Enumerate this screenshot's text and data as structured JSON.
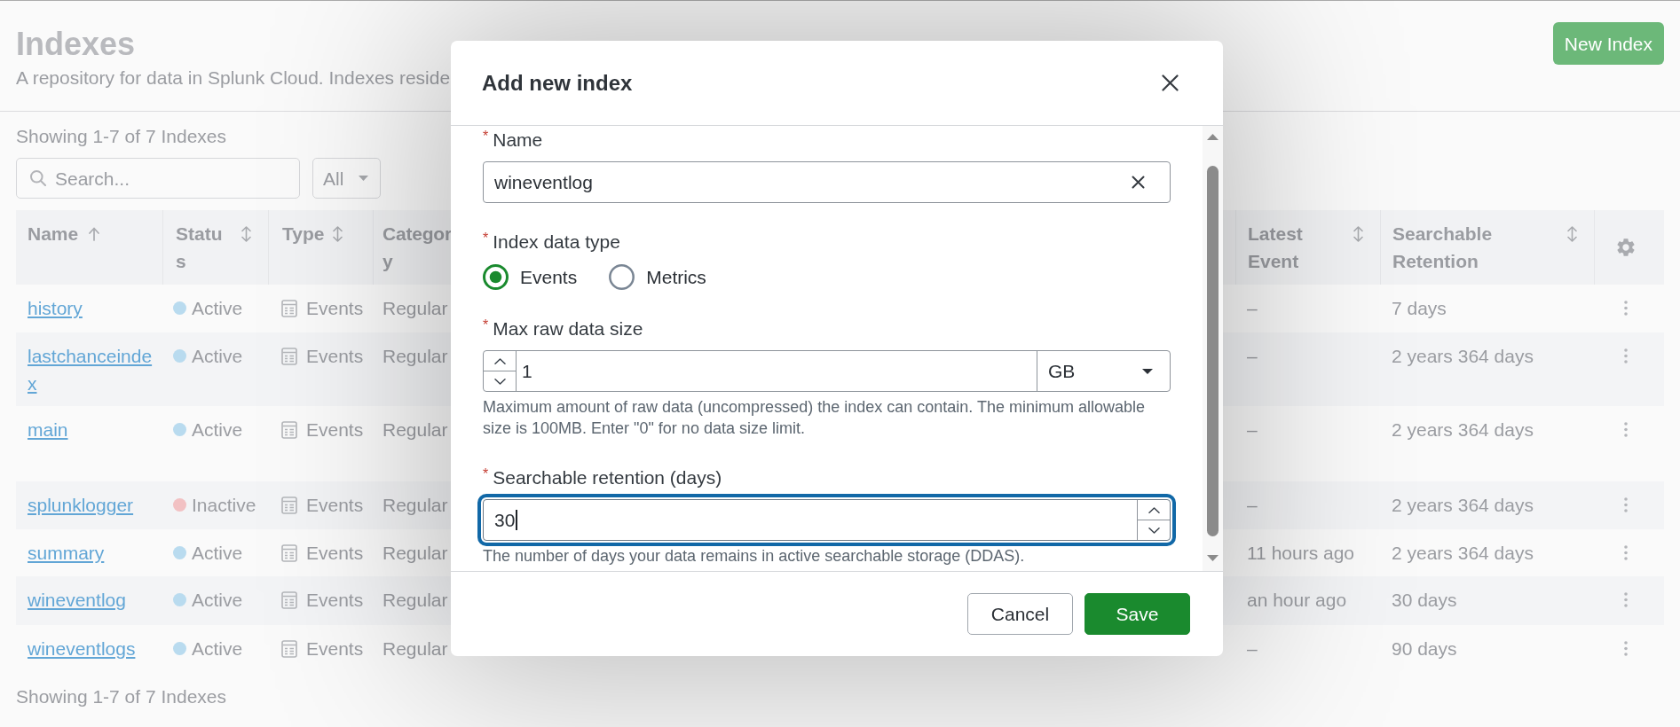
{
  "page": {
    "title": "Indexes",
    "description": "A repository for data in Splunk Cloud. Indexes reside",
    "new_button": "New Index",
    "count_top": "Showing 1-7 of 7 Indexes",
    "search": {
      "placeholder": "Search..."
    },
    "filter": {
      "value": "All"
    },
    "count_bottom": "Showing 1-7 of 7 Indexes"
  },
  "table": {
    "columns": [
      {
        "label": "Name",
        "sorted": true
      },
      {
        "label": "Status",
        "sorted": false
      },
      {
        "label": "Type",
        "sorted": false
      },
      {
        "label": "Category"
      },
      {
        "label": "Latest Event",
        "sorted": false
      },
      {
        "label": "Searchable Retention",
        "sorted": false
      }
    ],
    "rows": [
      {
        "name": "history",
        "status": "Active",
        "color": "#b9dbef",
        "type": "Events",
        "category": "Regular",
        "latest_event": "–",
        "retention": "7 days"
      },
      {
        "name": "lastchanceindex",
        "status": "Active",
        "color": "#b9dbef",
        "type": "Events",
        "category": "Regular",
        "latest_event": "–",
        "retention": "2 years 364 days"
      },
      {
        "name": "main",
        "status": "Active",
        "color": "#b9dbef",
        "type": "Events",
        "category": "Regular",
        "latest_event": "–",
        "retention": "2 years 364 days"
      },
      {
        "name": "splunklogger",
        "status": "Inactive",
        "color": "#f2c1c3",
        "type": "Events",
        "category": "Regular",
        "latest_event": "–",
        "retention": "2 years 364 days"
      },
      {
        "name": "summary",
        "status": "Active",
        "color": "#b9dbef",
        "type": "Events",
        "category": "Regular",
        "latest_event": "11 hours ago",
        "retention": "2 years 364 days"
      },
      {
        "name": "wineventlog",
        "status": "Active",
        "color": "#b9dbef",
        "type": "Events",
        "category": "Regular",
        "latest_event": "an hour ago",
        "retention": "30 days"
      },
      {
        "name": "wineventlogs",
        "status": "Active",
        "color": "#b9dbef",
        "type": "Events",
        "category": "Regular",
        "latest_event": "–",
        "retention": "90 days"
      }
    ]
  },
  "dialog": {
    "title": "Add new index",
    "fields": [
      {
        "kind": "text",
        "required_mark": "*",
        "label": "Name",
        "value": "wineventlog",
        "focused": false
      },
      {
        "kind": "radio",
        "required_mark": "*",
        "label": "Index data type",
        "options": [
          {
            "label": "Events",
            "selected": true
          },
          {
            "label": "Metrics",
            "selected": false
          }
        ]
      },
      {
        "kind": "size",
        "required_mark": "*",
        "label": "Max raw data size",
        "value": "1",
        "unit": "GB",
        "focused": false,
        "help": "Maximum amount of raw data (uncompressed) the index can contain. The minimum allowable size is 100MB. Enter \"0\" for no data size limit."
      },
      {
        "kind": "number",
        "required_mark": "*",
        "label": "Searchable retention (days)",
        "value": "30",
        "focused": true,
        "help": "The number of days your data remains in active searchable storage (DDAS)."
      }
    ],
    "buttons": [
      {
        "label": "Cancel",
        "kind": "secondary"
      },
      {
        "label": "Save",
        "kind": "primary"
      }
    ]
  }
}
